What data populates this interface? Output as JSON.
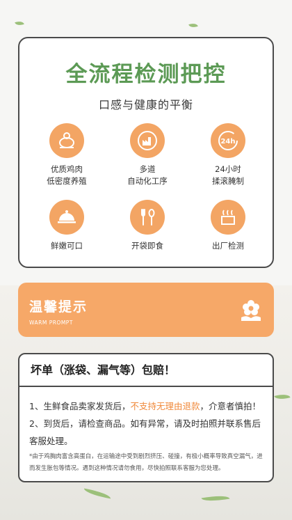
{
  "header": {
    "title": "全流程检测把控",
    "subtitle": "口感与健康的平衡"
  },
  "features": [
    {
      "label_line1": "优质鸡肉",
      "label_line2": "低密度养殖",
      "icon": "chicken-icon"
    },
    {
      "label_line1": "多道",
      "label_line2": "自动化工序",
      "icon": "factory-icon"
    },
    {
      "label_line1": "24小时",
      "label_line2": "揉滚腌制",
      "icon": "clock-24-icon",
      "icon_text": "24h"
    },
    {
      "label_line1": "鲜嫩可口",
      "label_line2": "",
      "icon": "cloche-icon"
    },
    {
      "label_line1": "开袋即食",
      "label_line2": "",
      "icon": "fork-spoon-icon"
    },
    {
      "label_line1": "出厂检测",
      "label_line2": "",
      "icon": "inspection-icon"
    }
  ],
  "banner": {
    "title": "温馨提示",
    "subtitle": "WARM PROMPT",
    "icon": "flower-icon"
  },
  "notice": {
    "title": "坏单（涨袋、漏气等）包赔！",
    "line1_prefix": "1、生鲜食品卖家发货后，",
    "line1_highlight": "不支持无理由退款",
    "line1_suffix": "，介意者慎拍！",
    "line2": "2、到货后，请检查商品。如有异常，请及时拍照并联系售后客服处理。",
    "footnote": "*由于鸡胸肉富含高蛋白，在运输途中受到剧烈挤压、碰撞，有极小概率导致真空漏气，进而发生胀包等情况。遇到这种情况请勿食用，尽快拍照联系客服为您处理。"
  },
  "colors": {
    "title_green": "#5c9a55",
    "accent_orange": "#f3a564",
    "highlight_orange": "#f08a3c",
    "border_dark": "#4a4a4a"
  }
}
